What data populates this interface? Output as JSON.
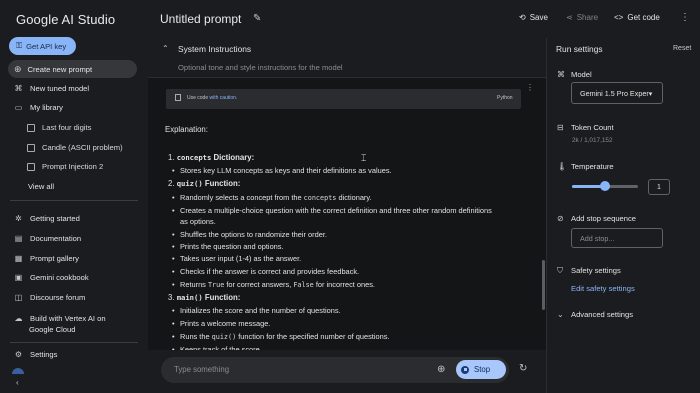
{
  "sidebar": {
    "brand": "Google AI Studio",
    "api_key_label": "Get API key",
    "new_prompt_label": "Create new prompt",
    "items": [
      {
        "label": "New tuned model",
        "icon": "tune-icon"
      },
      {
        "label": "My library",
        "icon": "folder-icon"
      }
    ],
    "library": [
      "Last four digits",
      "Candle (ASCII problem)",
      "Prompt Injection 2"
    ],
    "view_all": "View all",
    "links": [
      "Getting started",
      "Documentation",
      "Prompt gallery",
      "Gemini cookbook",
      "Discourse forum",
      "Build with Vertex AI on",
      "Google Cloud"
    ],
    "settings_label": "Settings"
  },
  "header": {
    "title": "Untitled prompt",
    "save_label": "Save",
    "share_label": "Share",
    "get_code_label": "Get code"
  },
  "system_instructions": {
    "title": "System Instructions",
    "placeholder": "Optional tone and style instructions for the model"
  },
  "code_block": {
    "prefix": "Use code ",
    "link": "with caution.",
    "language": "Python"
  },
  "response": {
    "heading": "Explanation:",
    "sections": [
      {
        "num": "1.",
        "code": "concepts",
        "title": "Dictionary:",
        "bullets": [
          {
            "text": "Stores key LLM concepts as keys and their definitions as values."
          }
        ]
      },
      {
        "num": "2.",
        "code": "quiz()",
        "title": "Function:",
        "bullets": [
          {
            "text": "Randomly selects a concept from the ",
            "code": "concepts",
            "after": " dictionary."
          },
          {
            "text": "Creates a multiple-choice question with the correct definition and three other random definitions"
          },
          {
            "text": "as options."
          },
          {
            "text": "Shuffles the options to randomize their order."
          },
          {
            "text": "Prints the question and options."
          },
          {
            "text": "Takes user input (1-4) as the answer."
          },
          {
            "text": "Checks if the answer is correct and provides feedback."
          },
          {
            "text": "Returns ",
            "code": "True",
            "after": " for correct answers, ",
            "code2": "False",
            "after2": " for incorrect ones."
          }
        ]
      },
      {
        "num": "3.",
        "code": "main()",
        "title": "Function:",
        "bullets": [
          {
            "text": "Initializes the score and the number of questions."
          },
          {
            "text": "Prints a welcome message."
          },
          {
            "text": "Runs the ",
            "code": "quiz()",
            "after": " function for the specified number of questions."
          },
          {
            "text": "Keeps track of the score."
          }
        ]
      }
    ]
  },
  "input": {
    "placeholder": "Type something",
    "stop_label": "Stop"
  },
  "run_settings": {
    "title": "Run settings",
    "reset_label": "Reset",
    "model_label": "Model",
    "model_value": "Gemini 1.5 Pro Exper▾",
    "token_label": "Token Count",
    "token_value": "2k / 1,017,152",
    "temperature_label": "Temperature",
    "temperature_value": "1",
    "temperature_fraction": 0.5,
    "stop_seq_label": "Add stop sequence",
    "stop_seq_placeholder": "Add stop...",
    "safety_label": "Safety settings",
    "safety_link": "Edit safety settings",
    "advanced_label": "Advanced settings"
  },
  "colors": {
    "accent": "#8ab4f8",
    "background": "#1b1c1f"
  }
}
